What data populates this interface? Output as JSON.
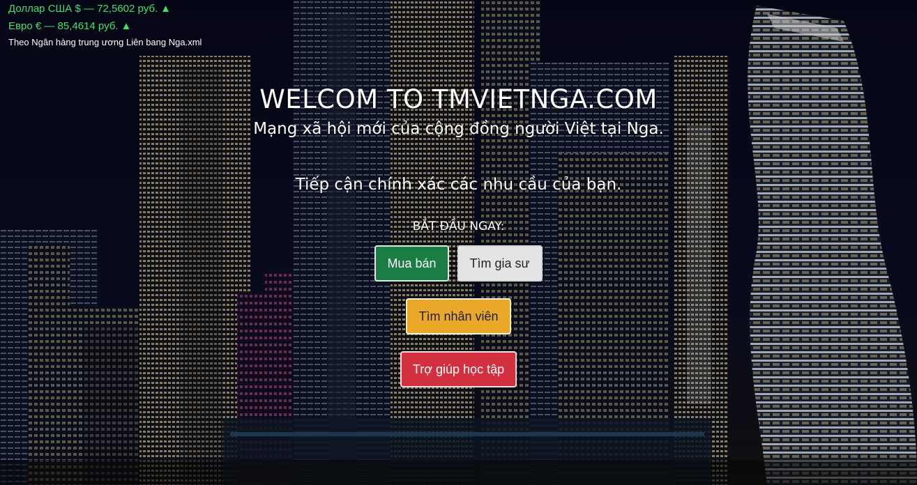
{
  "rates": {
    "usd": "Доллар США $ — 72,5602 руб.",
    "eur": "Евро € — 85,4614 руб.",
    "arrow": "▲",
    "source": "Theo Ngân hàng trung ương Liên bang Nga.xml",
    "color": "#39e36a"
  },
  "hero": {
    "title": "WELCOM TO TMVIETNGA.COM",
    "subtitle": "Mạng xã hội mới của cộng đồng người Việt tại Nga.",
    "tagline": "Tiếp cận chính xác các nhu cầu của bạn.",
    "start_label": "BẮT ĐẦU NGAY:"
  },
  "buttons": {
    "buy_sell": "Mua bán",
    "find_tutor": "Tìm gia sư",
    "find_staff": "Tìm nhân viên",
    "study_help": "Trợ giúp học tập"
  },
  "colors": {
    "green": "#1a7d44",
    "light": "#e3e4e6",
    "yellow": "#e9a82a",
    "red": "#d3303f"
  }
}
